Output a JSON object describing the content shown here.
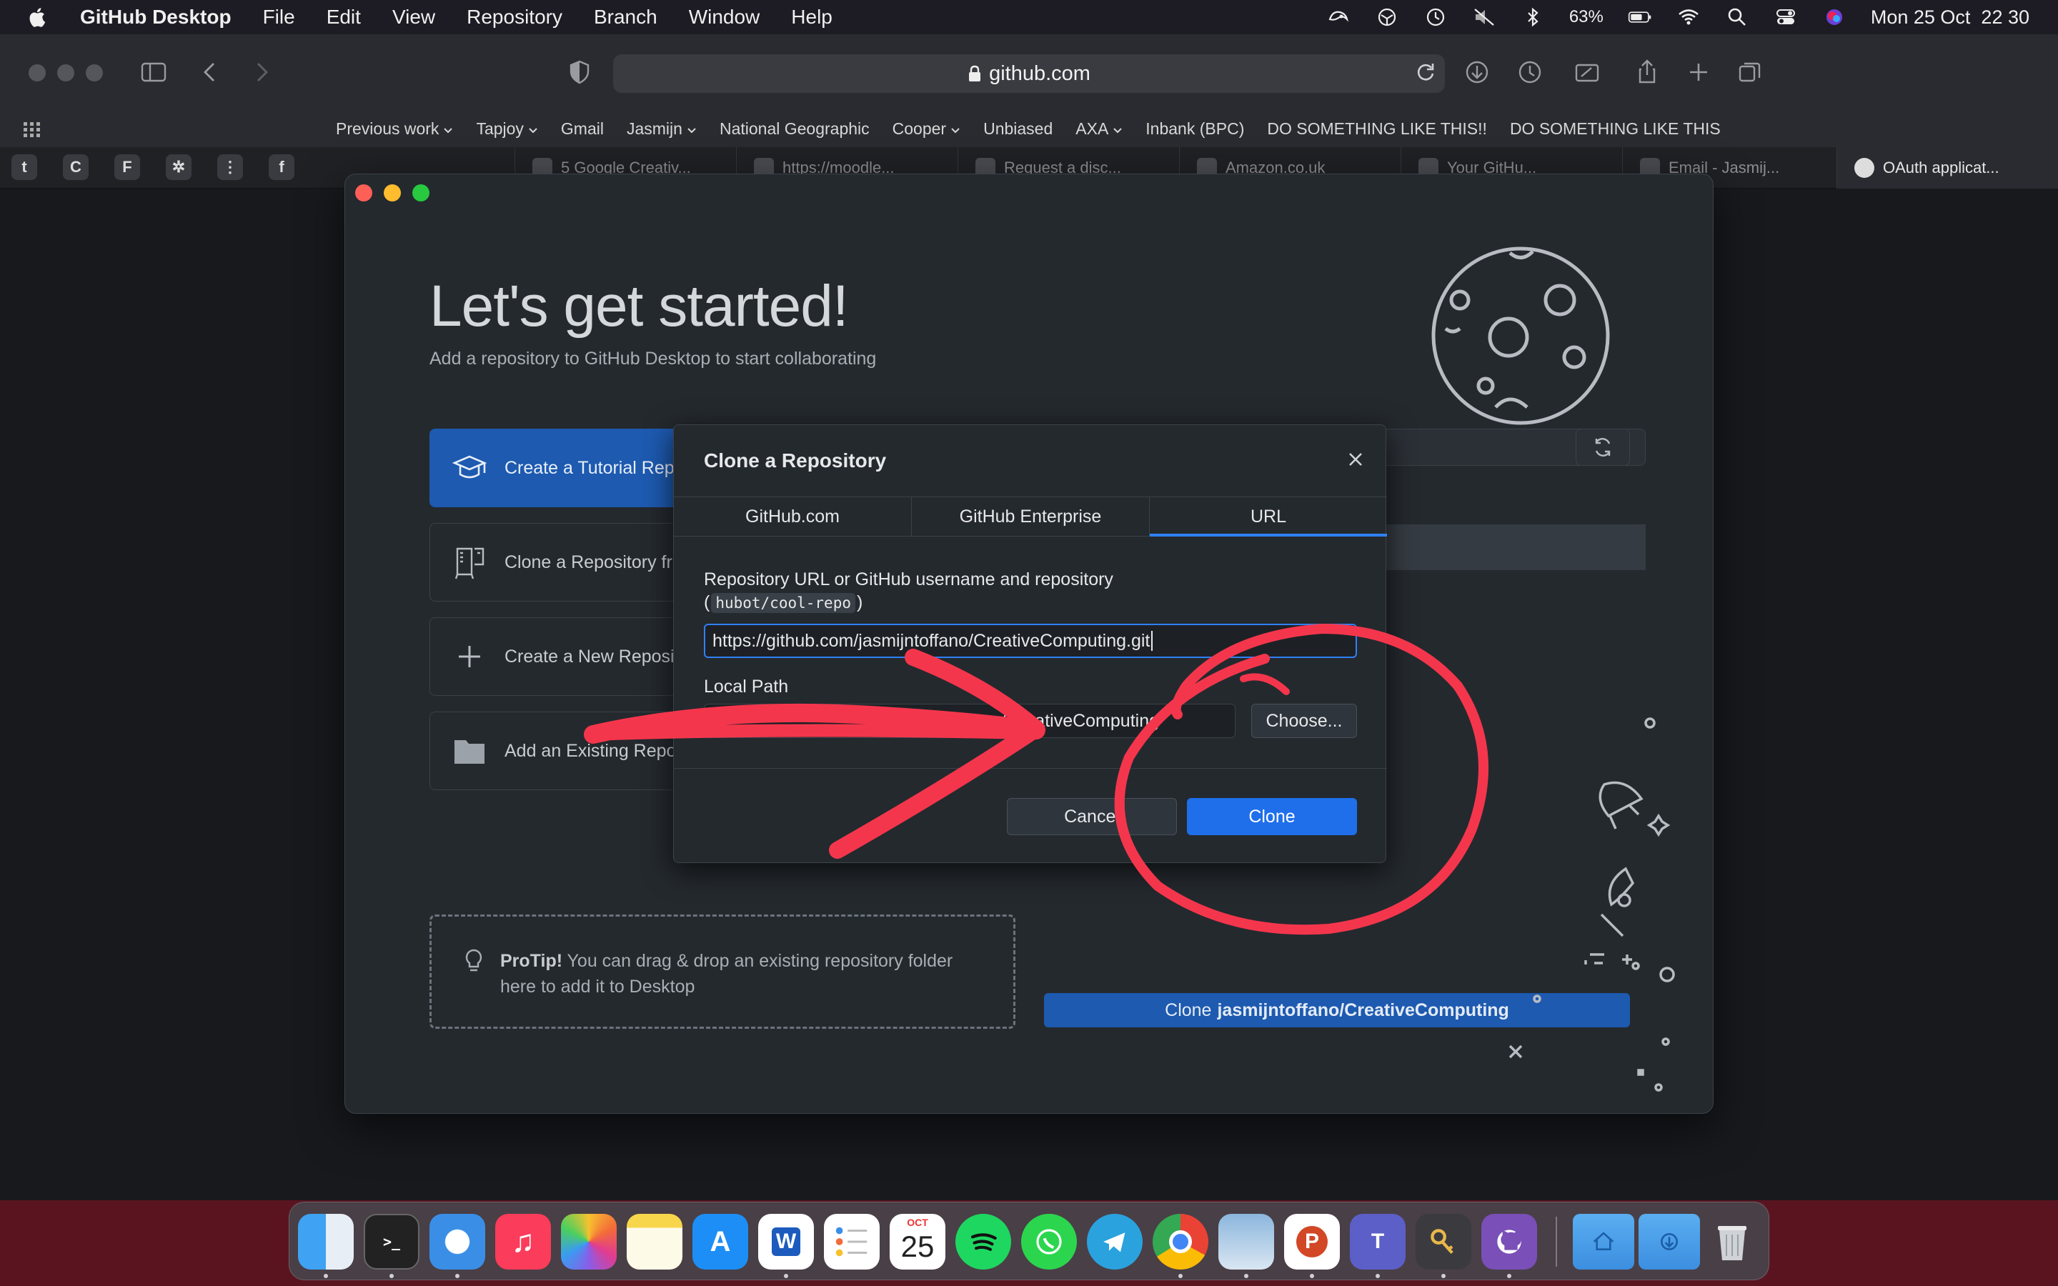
{
  "menubar": {
    "app_name": "GitHub Desktop",
    "items": [
      "File",
      "Edit",
      "View",
      "Repository",
      "Branch",
      "Window",
      "Help"
    ],
    "battery": "63%",
    "datetime": "Mon 25 Oct  22 30"
  },
  "safari": {
    "address": "github.com",
    "bookmarks": [
      {
        "label": "Previous work",
        "folder": true
      },
      {
        "label": "Tapjoy",
        "folder": true
      },
      {
        "label": "Gmail",
        "folder": false
      },
      {
        "label": "Jasmijn",
        "folder": true
      },
      {
        "label": "National Geographic",
        "folder": false
      },
      {
        "label": "Cooper",
        "folder": true
      },
      {
        "label": "Unbiased",
        "folder": false
      },
      {
        "label": "AXA",
        "folder": true
      },
      {
        "label": "Inbank (BPC)",
        "folder": false
      },
      {
        "label": "DO SOMETHING LIKE THIS!!",
        "folder": false
      },
      {
        "label": "DO SOMETHING LIKE THIS",
        "folder": false
      }
    ],
    "pinned_tabs": [
      "t",
      "C",
      "F",
      "✲",
      "⋮",
      "f"
    ],
    "tabs": [
      "5 Google Creativ...",
      "https://moodle...",
      "Request a disc...",
      "Amazon.co.uk",
      "Your GitHu...",
      "Email - Jasmij...",
      "OAuth applicat..."
    ]
  },
  "ghd": {
    "title": "Let's get started!",
    "subtitle": "Add a repository to GitHub Desktop to start collaborating",
    "actions": [
      {
        "label": "Create a Tutorial Repository...",
        "icon": "mortarboard-icon"
      },
      {
        "label": "Clone a Repository from the Internet...",
        "icon": "repo-clone-icon"
      },
      {
        "label": "Create a New Repository on your hard drive...",
        "icon": "plus-icon"
      },
      {
        "label": "Add an Existing Repository from your hard drive...",
        "icon": "folder-icon"
      }
    ],
    "protip": {
      "bold": "ProTip!",
      "line1": " You can drag & drop an existing repository folder",
      "line2": "here to add it to Desktop"
    },
    "clone_button": {
      "prefix": "Clone",
      "repo": "jasmijntoffano/CreativeComputing"
    }
  },
  "modal": {
    "title": "Clone a Repository",
    "tabs": [
      "GitHub.com",
      "GitHub Enterprise",
      "URL"
    ],
    "active_tab": "URL",
    "url_label": "Repository URL or GitHub username and repository",
    "url_example_open": "(",
    "url_example": "hubot/cool-repo",
    "url_example_close": ")",
    "url_value": "https://github.com/jasmijntoffano/CreativeComputing.git",
    "path_label": "Local Path",
    "path_value": "/CreativeComputing",
    "choose_label": "Choose...",
    "cancel_label": "Cancel",
    "clone_label": "Clone"
  },
  "colors": {
    "accent_blue": "#1f6feb",
    "annotation_red": "#f4364c"
  },
  "dock": {
    "calendar_month": "OCT",
    "calendar_day": "25",
    "apps": [
      "finder-icon",
      "terminal-icon",
      "safari-icon",
      "music-icon",
      "photos-icon",
      "notes-icon",
      "app-store-icon",
      "word-icon",
      "reminders-icon",
      "calendar-icon",
      "spotify-icon",
      "whatsapp-icon",
      "telegram-icon",
      "chrome-icon",
      "preview-icon",
      "powerpoint-icon",
      "teams-icon",
      "keychain-icon",
      "github-desktop-icon",
      "home-folder-icon",
      "downloads-folder-icon",
      "trash-icon"
    ]
  }
}
